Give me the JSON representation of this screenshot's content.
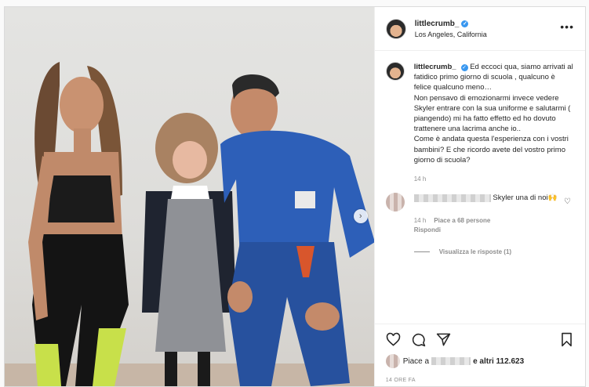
{
  "post": {
    "username": "littlecrumb_",
    "location": "Los Angeles, California",
    "more_label": "•••",
    "verified_mark": "✓"
  },
  "caption": {
    "username": "littlecrumb_",
    "text": "Ed eccoci qua, siamo arrivati al fatidico primo giorno di scuola , qualcuno è felice qualcuno meno…",
    "text2": "Non pensavo di emozionarmi invece vedere Skyler entrare con la sua uniforme e salutarmi ( piangendo) mi ha fatto effetto ed ho dovuto trattenere una lacrima anche io..",
    "text3": "Come è andata questa l'esperienza con i vostri bambini? E che ricordo avete del vostro primo giorno di scuola?",
    "time": "14 h"
  },
  "comment": {
    "text": "Skyler una di noi🙌",
    "time": "14 h",
    "likes": "Piace a 68 persone",
    "reply": "Rispondi",
    "view_replies": "Visualizza le risposte (1)"
  },
  "footer": {
    "likes_prefix": "Piace a",
    "likes_suffix": "e altri 112.623",
    "time_ago": "14 ORE FA"
  },
  "photo": {
    "next_label": "›"
  }
}
